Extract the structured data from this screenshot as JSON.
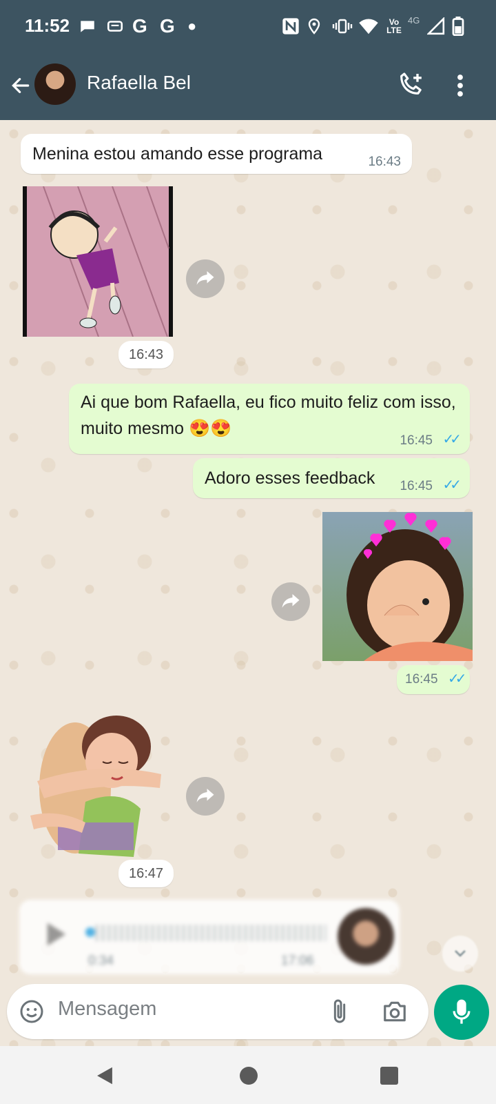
{
  "status_bar": {
    "time": "11:52",
    "icons": [
      "chat-bubble-icon",
      "message-icon",
      "google-icon",
      "google-icon",
      "dot-icon",
      "nfc-icon",
      "location-icon",
      "vibrate-icon",
      "wifi-icon",
      "volte-icon",
      "signal-4g-icon",
      "battery-icon"
    ],
    "volte": "Vo LTE",
    "net": "4G"
  },
  "header": {
    "contact_name": "Rafaella Bel"
  },
  "messages": [
    {
      "type": "text",
      "direction": "in",
      "text": "Menina estou amando esse programa",
      "time": "16:43"
    },
    {
      "type": "sticker",
      "direction": "in",
      "description": "sticker-girl-dancing",
      "time": "16:43"
    },
    {
      "type": "text",
      "direction": "out",
      "text": "Ai que bom Rafaella, eu fico muito feliz com isso, muito mesmo 😍😍",
      "time": "16:45",
      "read": true
    },
    {
      "type": "text",
      "direction": "out",
      "text": "Adoro esses feedback",
      "time": "16:45",
      "read": true
    },
    {
      "type": "image",
      "direction": "out",
      "description": "photo-child-hearts",
      "time": "16:45",
      "read": true
    },
    {
      "type": "sticker",
      "direction": "in",
      "description": "sticker-hug",
      "time": "16:47"
    },
    {
      "type": "audio",
      "direction": "in",
      "duration": "0:34",
      "time": "17:06"
    }
  ],
  "input": {
    "placeholder": "Mensagem"
  },
  "colors": {
    "header": "#3d5461",
    "outgoing_bubble": "#e4fcd1",
    "accent": "#00a884",
    "read_ticks": "#36a9e6"
  }
}
